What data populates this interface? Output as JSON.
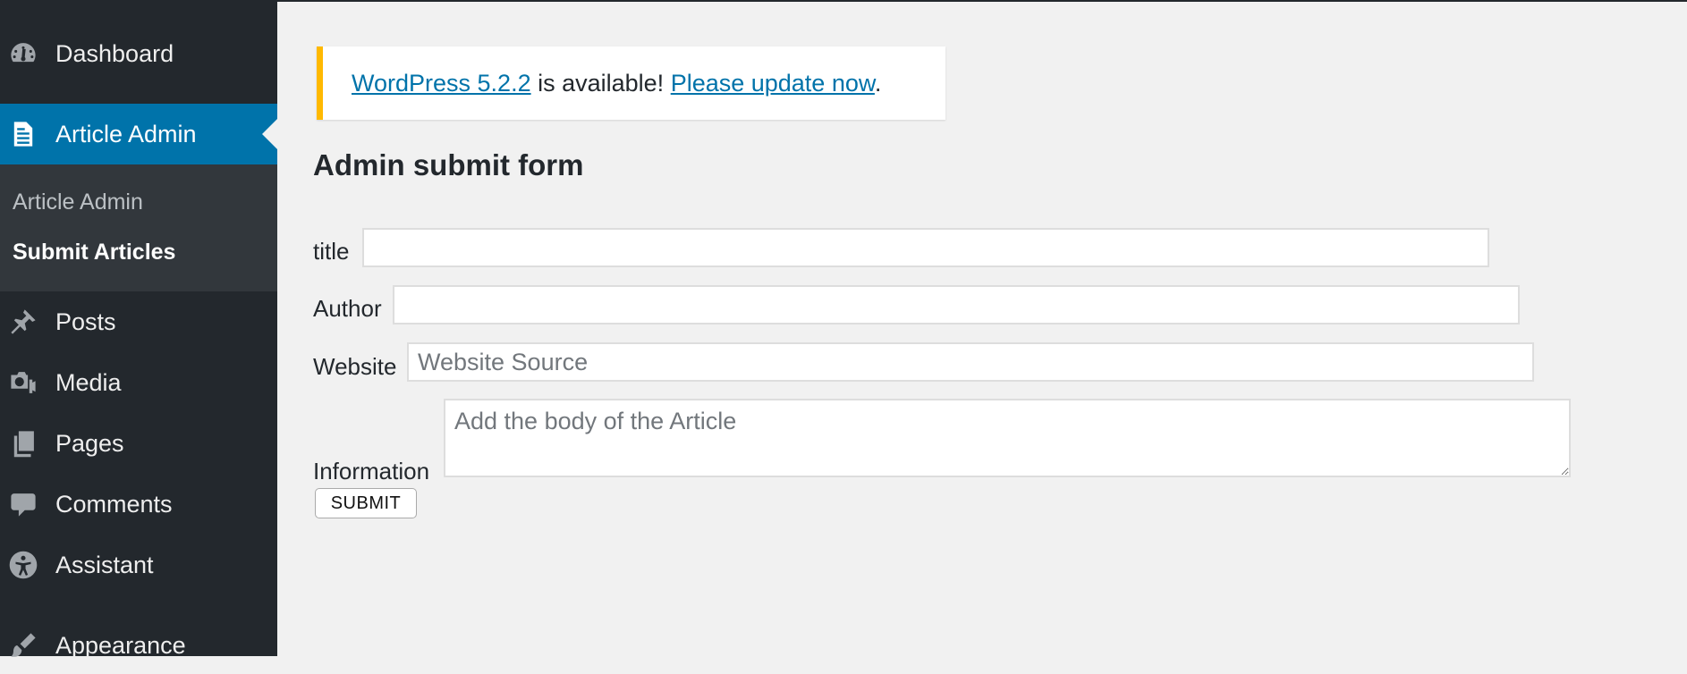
{
  "sidebar": {
    "items": [
      {
        "label": "Dashboard",
        "icon": "dashboard-icon"
      },
      {
        "label": "Article Admin",
        "icon": "document-icon",
        "current": true
      },
      {
        "label": "Posts",
        "icon": "pushpin-icon"
      },
      {
        "label": "Media",
        "icon": "media-icon"
      },
      {
        "label": "Pages",
        "icon": "pages-icon"
      },
      {
        "label": "Comments",
        "icon": "comment-icon"
      },
      {
        "label": "Assistant",
        "icon": "accessibility-icon"
      },
      {
        "label": "Appearance",
        "icon": "paintbrush-icon"
      }
    ],
    "submenu": [
      {
        "label": "Article Admin"
      },
      {
        "label": "Submit Articles",
        "active": true
      }
    ]
  },
  "notice": {
    "version_link": "WordPress 5.2.2",
    "middle_text": " is available! ",
    "update_link": "Please update now",
    "end_text": "."
  },
  "form": {
    "heading": "Admin submit form",
    "title_label": "title",
    "title_value": "",
    "author_label": "Author",
    "author_value": "",
    "website_label": "Website",
    "website_placeholder": "Website Source",
    "information_label": "Information",
    "information_placeholder": "Add the body of the Article",
    "submit_label": "SUBMIT"
  },
  "colors": {
    "sidebar_bg": "#23282d",
    "submenu_bg": "#32373c",
    "accent": "#0073aa",
    "notice_border": "#ffb900",
    "page_bg": "#f1f1f1"
  }
}
